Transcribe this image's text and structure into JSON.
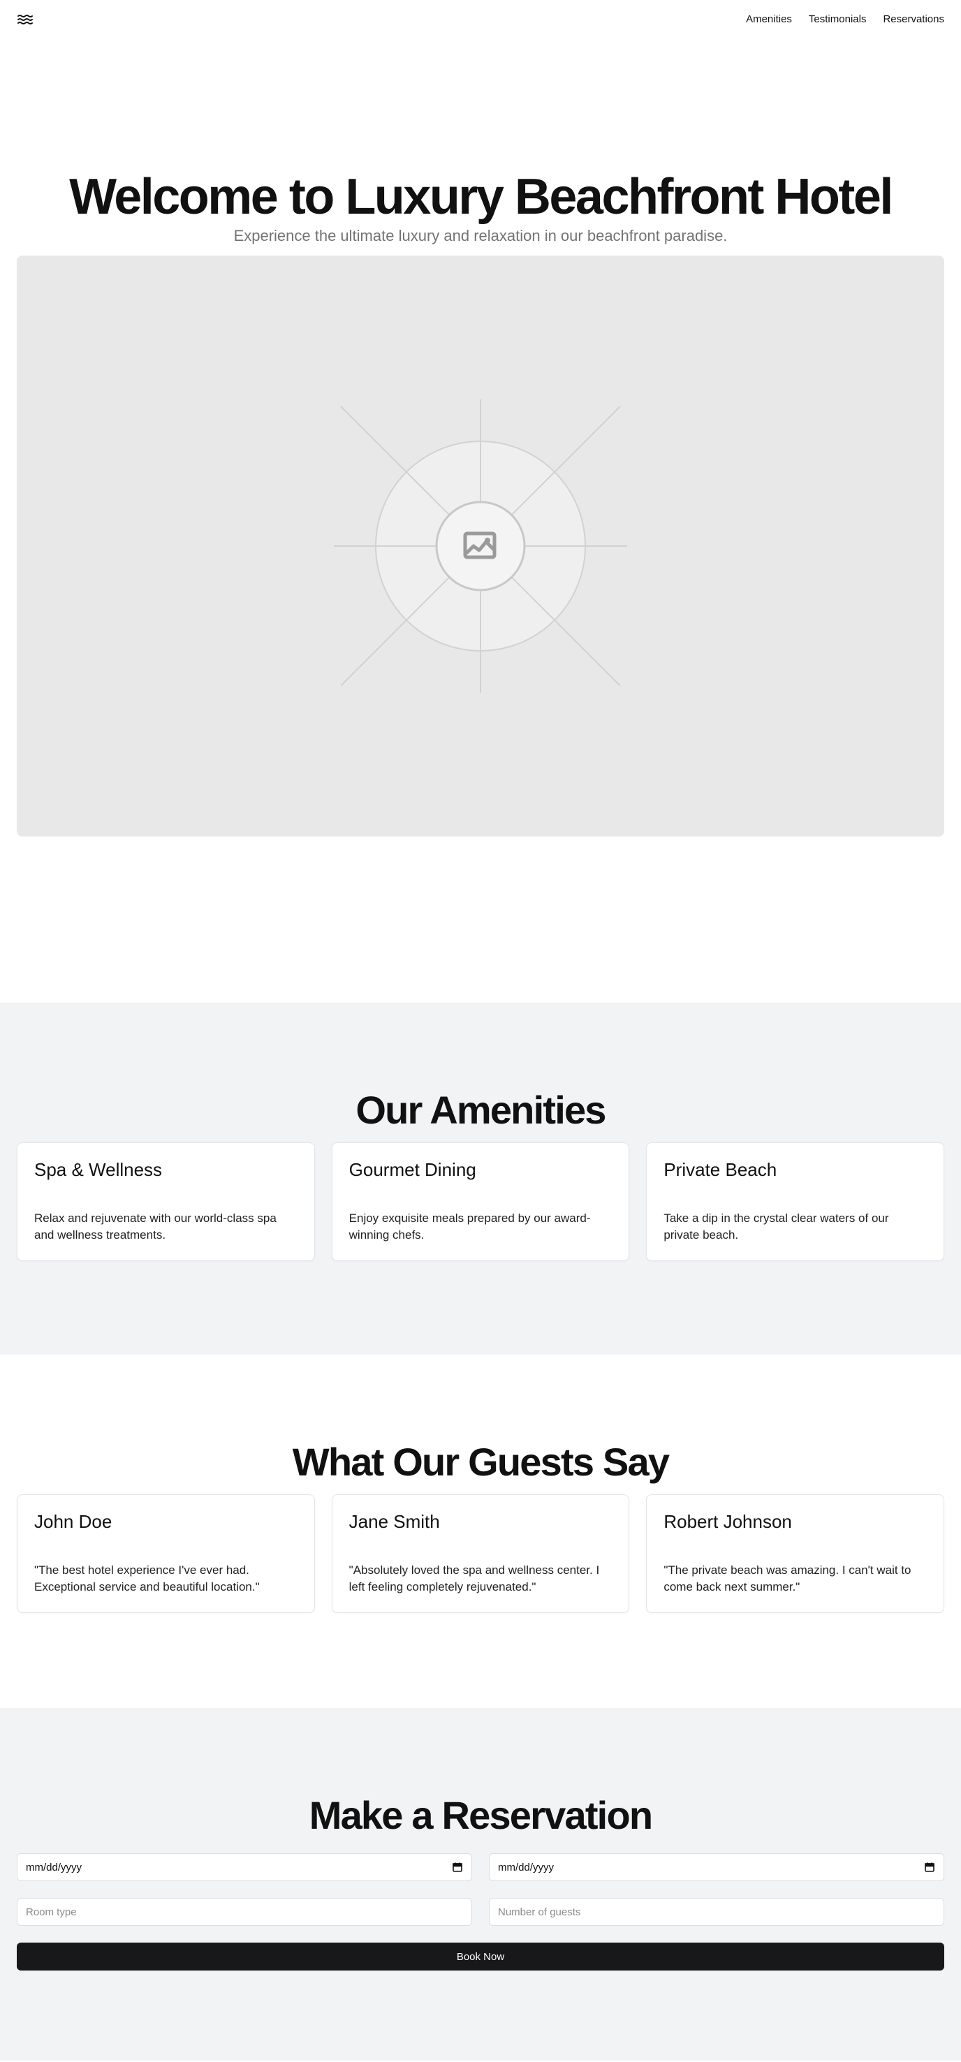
{
  "nav": {
    "logo_icon": "waves-icon",
    "links": [
      "Amenities",
      "Testimonials",
      "Reservations"
    ]
  },
  "hero": {
    "title": "Welcome to Luxury Beachfront Hotel",
    "subtitle": "Experience the ultimate luxury and relaxation in our beachfront paradise.",
    "image_icon": "image-placeholder-icon"
  },
  "amenities": {
    "title": "Our Amenities",
    "items": [
      {
        "title": "Spa & Wellness",
        "text": "Relax and rejuvenate with our world-class spa and wellness treatments."
      },
      {
        "title": "Gourmet Dining",
        "text": "Enjoy exquisite meals prepared by our award-winning chefs."
      },
      {
        "title": "Private Beach",
        "text": "Take a dip in the crystal clear waters of our private beach."
      }
    ]
  },
  "testimonials": {
    "title": "What Our Guests Say",
    "items": [
      {
        "name": "John Doe",
        "quote": "\"The best hotel experience I've ever had. Exceptional service and beautiful location.\""
      },
      {
        "name": "Jane Smith",
        "quote": "\"Absolutely loved the spa and wellness center. I left feeling completely rejuvenated.\""
      },
      {
        "name": "Robert Johnson",
        "quote": "\"The private beach was amazing. I can't wait to come back next summer.\""
      }
    ]
  },
  "reservation": {
    "title": "Make a Reservation",
    "checkin_value": "mm/dd/yyyy",
    "checkout_value": "mm/dd/yyyy",
    "room_type_placeholder": "Room type",
    "guests_placeholder": "Number of guests",
    "submit_label": "Book Now"
  },
  "colors": {
    "section_gray": "#f2f3f5",
    "button_dark": "#18181b",
    "muted_text": "#737373"
  }
}
